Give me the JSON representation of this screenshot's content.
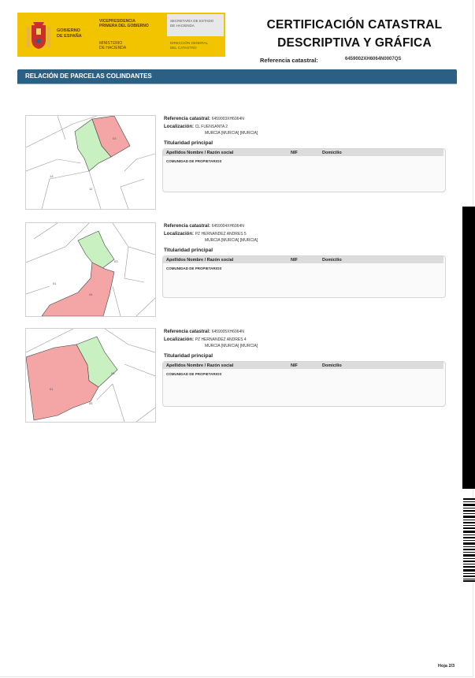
{
  "header": {
    "gobierno": [
      "GOBIERNO",
      "DE ESPAÑA"
    ],
    "vicepresidencia": [
      "VICEPRESIDENCIA",
      "PRIMERA DEL GOBIERNO"
    ],
    "ministerio": [
      "MINISTERIO",
      "DE HACIENDA"
    ],
    "secretaria": [
      "SECRETARÍA DE ESTADO",
      "DE HACIENDA"
    ],
    "direccion": [
      "DIRECCIÓN GENERAL",
      "DEL CATASTRO"
    ]
  },
  "title": [
    "CERTIFICACIÓN CATASTRAL",
    "DESCRIPTIVA Y GRÁFICA"
  ],
  "reference": {
    "label": "Referencia catastral:",
    "value": "6459002XH6064N0007QS"
  },
  "section_title": "RELACIÓN DE PARCELAS COLINDANTES",
  "labels": {
    "ref": "Referencia catastral:",
    "loc": "Localización:",
    "titularidad": "Titularidad principal",
    "col_nombre": "Apellidos Nombre / Razón social",
    "col_nif": "NIF",
    "col_domicilio": "Domicilio"
  },
  "parcels": [
    {
      "ref": "6459003XH6064N",
      "loc1": "CL FUENSANTA 2",
      "loc2": "MURCIA [MURCIA] [MURCIA]",
      "owner": "COMUNIDAD DE PROPIETARIOS"
    },
    {
      "ref": "6459004XH6064N",
      "loc1": "PZ HERNANDEZ ANDRES 5",
      "loc2": "MURCIA [MURCIA] [MURCIA]",
      "owner": "COMUNIDAD DE PROPIETARIOS"
    },
    {
      "ref": "6459005XH6064N",
      "loc1": "PZ HERNANDEZ ANDRES 4",
      "loc2": "MURCIA [MURCIA] [MURCIA]",
      "owner": "COMUNIDAD DE PROPIETARIOS"
    }
  ],
  "footer": "Hoja 2/3",
  "colors": {
    "section_bar": "#2c5f84",
    "header_yellow": "#f2c400",
    "subject_parcel": "#c8f0c0",
    "neighbor_parcel": "#f4a6a6"
  }
}
